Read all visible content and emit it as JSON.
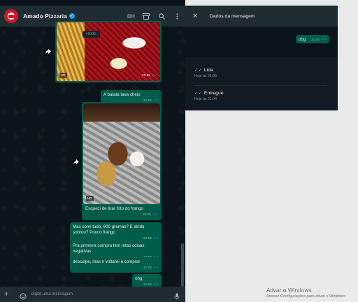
{
  "header": {
    "contact_name": "Amado Pizzaria",
    "verified": true,
    "icons": [
      "video-icon",
      "store-icon",
      "search-icon",
      "menu-icon"
    ]
  },
  "chat": {
    "date_chip": "HOJE",
    "messages": [
      {
        "type": "image",
        "badge": "HD",
        "time": "20:55"
      },
      {
        "type": "text",
        "text": "A batata tava cheio",
        "time": "20:55"
      },
      {
        "type": "image",
        "badge": "HD",
        "caption": "Esqueci de tirar foto do frango",
        "time": "20:55"
      },
      {
        "type": "text",
        "text": "Mas comi tudo, 600 gramas? E ainda sobrou? Pouco frango",
        "time": "20:56"
      },
      {
        "type": "text",
        "text": "Pra primeira compra tem mtas coisas negativas",
        "time": "20:56"
      },
      {
        "type": "text",
        "text": "desculpe, mas n voltarei a comprar",
        "time": "21:04"
      },
      {
        "type": "text",
        "text": "obg",
        "time": "21:04"
      }
    ]
  },
  "composer": {
    "placeholder": "Digite uma mensagem"
  },
  "info": {
    "title": "Dados da mensagem",
    "message_text": "obg",
    "message_time": "21:04",
    "statuses": [
      {
        "label": "Lida",
        "time": "Hoje às 21:06"
      },
      {
        "label": "Entregue",
        "time": "Hoje às 21:04"
      }
    ]
  },
  "windows_watermark": {
    "title": "Ativar o Windows",
    "subtitle": "Acesse Configurações para ativar o Windows"
  },
  "colors": {
    "outgoing_bubble": "#005c4b",
    "read_ticks": "#53bdeb",
    "header_bg": "#202c33",
    "chat_bg": "#0b141a"
  }
}
